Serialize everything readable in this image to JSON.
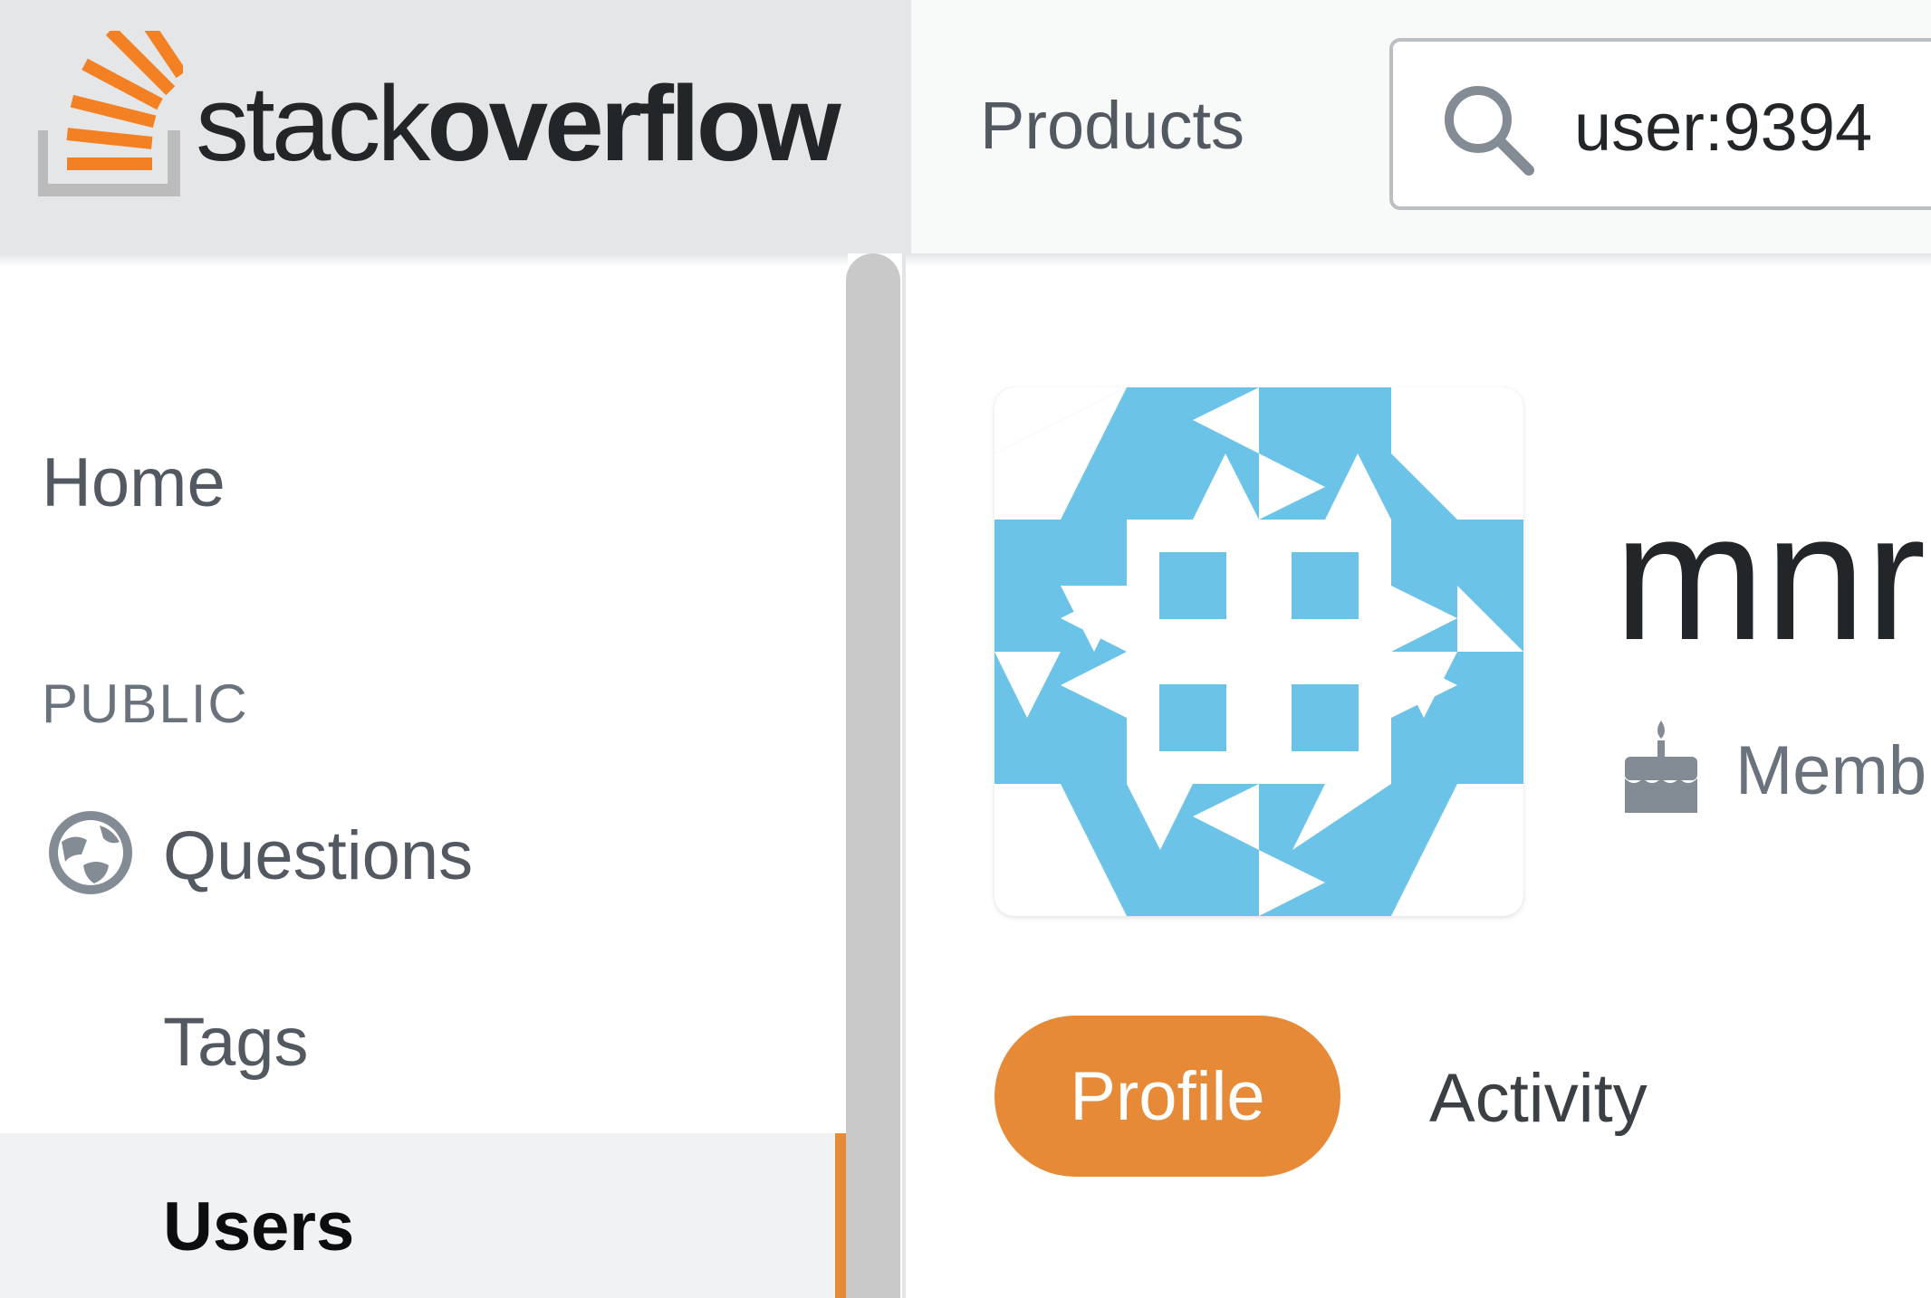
{
  "header": {
    "logo": {
      "text_regular": "stack",
      "text_bold": "overflow",
      "icon": "stackoverflow-logo-icon"
    },
    "nav_products": "Products",
    "search": {
      "value": "user:9394",
      "icon": "search-icon"
    }
  },
  "sidebar": {
    "home": "Home",
    "section_public": "PUBLIC",
    "questions": {
      "label": "Questions",
      "icon": "globe-icon"
    },
    "tags": "Tags",
    "users": "Users"
  },
  "profile": {
    "name": "mnr",
    "member_text": "Memb",
    "member_icon": "cake-icon",
    "avatar_colors": {
      "primary": "#6cc3e8",
      "secondary": "#ffffff"
    }
  },
  "tabs": [
    {
      "label": "Profile",
      "active": true
    },
    {
      "label": "Activity",
      "active": false
    }
  ],
  "colors": {
    "accent": "#e68a38",
    "text": "#232629",
    "muted": "#525960"
  }
}
